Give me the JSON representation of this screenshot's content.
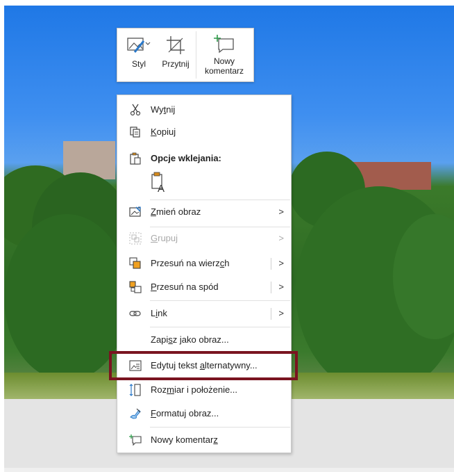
{
  "mini_toolbar": {
    "style_label": "Styl",
    "crop_label": "Przytnij",
    "new_comment_label_line1": "Nowy",
    "new_comment_label_line2": "komentarz"
  },
  "menu": {
    "cut": {
      "pre": "Wy",
      "acc": "t",
      "post": "nij"
    },
    "copy": {
      "pre": "",
      "acc": "K",
      "post": "opiuj"
    },
    "paste_options": "Opcje wklejania:",
    "change_picture": {
      "pre": "",
      "acc": "Z",
      "post": "mień obraz"
    },
    "group": {
      "pre": "",
      "acc": "G",
      "post": "rupuj"
    },
    "bring_forward": {
      "pre": "Przesuń na wierz",
      "acc": "c",
      "post": "h"
    },
    "send_backward": {
      "pre": "",
      "acc": "P",
      "post": "rzesuń na spód"
    },
    "link": {
      "pre": "L",
      "acc": "i",
      "post": "nk"
    },
    "save_as_picture": {
      "pre": "Zapi",
      "acc": "s",
      "post": "z jako obraz..."
    },
    "edit_alt_text": {
      "pre": "Edytuj tekst ",
      "acc": "a",
      "post": "lternatywny..."
    },
    "size_position": {
      "pre": "Roz",
      "acc": "m",
      "post": "iar i położenie..."
    },
    "format_picture": {
      "pre": "",
      "acc": "F",
      "post": "ormatuj obraz..."
    },
    "new_comment": {
      "pre": "Nowy komentar",
      "acc": "z",
      "post": ""
    },
    "submenu_arrow": ">"
  },
  "colors": {
    "highlight_border": "#7a1420",
    "accent_icon": "#d58a1c"
  }
}
